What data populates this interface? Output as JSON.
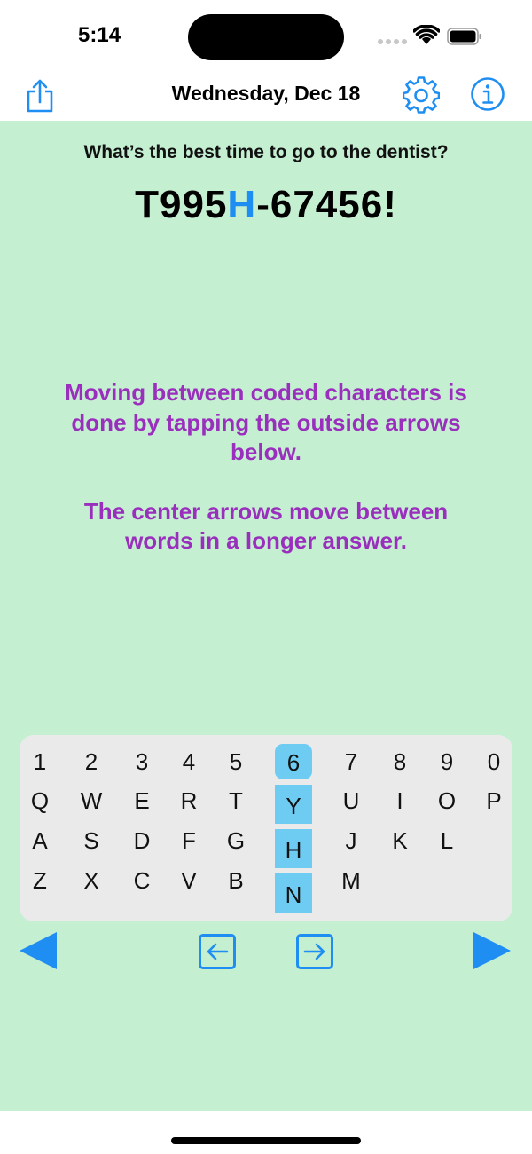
{
  "status_bar": {
    "time": "5:14"
  },
  "nav": {
    "date": "Wednesday, Dec 18"
  },
  "puzzle": {
    "question": "What’s the best time to go to the dentist?",
    "code_prefix": "T995",
    "code_highlight": "H",
    "code_suffix": "-67456!"
  },
  "instructions": {
    "line1": "Moving between coded characters is done by tapping the outside arrows below.",
    "line2": "The center arrows move between words in a longer answer."
  },
  "keyboard": {
    "rows": [
      [
        "1",
        "2",
        "3",
        "4",
        "5",
        "6",
        "7",
        "8",
        "9",
        "0"
      ],
      [
        "Q",
        "W",
        "E",
        "R",
        "T",
        "Y",
        "U",
        "I",
        "O",
        "P"
      ],
      [
        "A",
        "S",
        "D",
        "F",
        "G",
        "H",
        "J",
        "K",
        "L"
      ],
      [
        "Z",
        "X",
        "C",
        "V",
        "B",
        "N",
        "M"
      ]
    ],
    "selected_column": [
      "6",
      "Y",
      "H",
      "N"
    ]
  },
  "colors": {
    "background": "#c4efd1",
    "accent": "#1f8ef2",
    "instructions": "#9a2fbd",
    "column_highlight": "#6ecbf2",
    "keyboard_bg": "#eaeaea"
  },
  "icons": [
    "share-icon",
    "gear-icon",
    "info-icon",
    "left-arrow-icon",
    "right-arrow-icon",
    "word-left-icon",
    "word-right-icon"
  ]
}
